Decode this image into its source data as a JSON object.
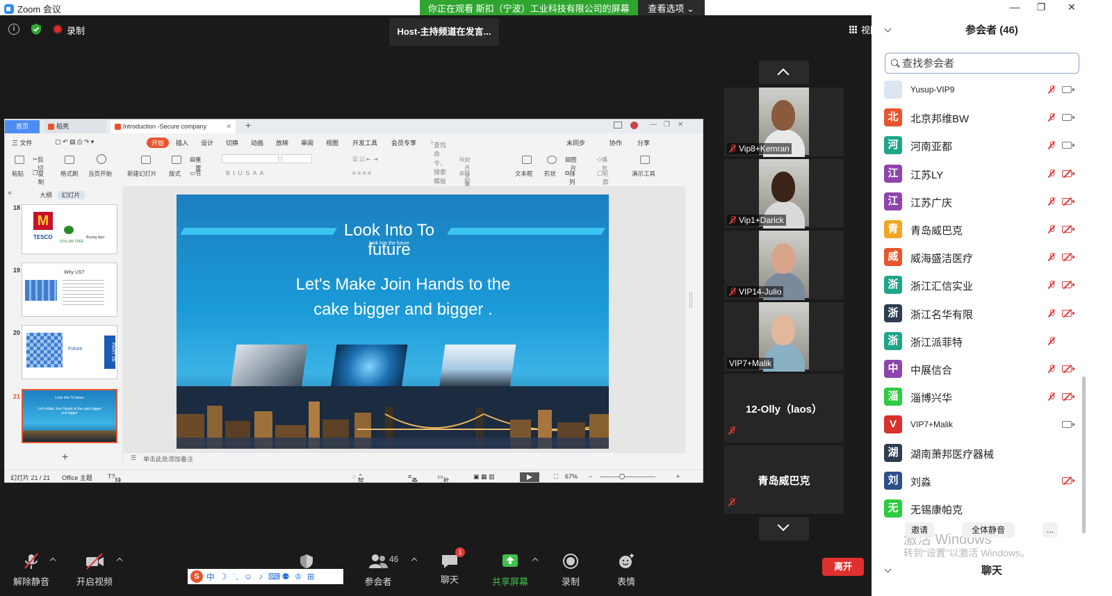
{
  "window": {
    "title": "Zoom 会议",
    "share_banner": "你正在观看 斯扣（宁波）工业科技有限公司的屏幕",
    "view_options": "查看选项 ⌄"
  },
  "meeting": {
    "recording_label": "录制",
    "speaker_banner": "Host-主持频道在发言...",
    "view_label": "视图"
  },
  "wps": {
    "tabs": {
      "home": "首页",
      "shell": "稻壳",
      "doc": "Introduction -Secure company"
    },
    "menu": {
      "file": "三 文件",
      "start": "开始",
      "items": [
        "插入",
        "设计",
        "切换",
        "动画",
        "放映",
        "审阅",
        "视图",
        "开发工具",
        "会员专享"
      ],
      "search": "查找命令、搜索模板",
      "right": [
        "未同步",
        "协作",
        "分享"
      ]
    },
    "ribbon": {
      "paste": "粘贴",
      "cut": "剪切",
      "copy": "复制",
      "format_painter": "格式刷",
      "play_from_current": "当页开始",
      "new_slide": "新建幻灯片",
      "layout": "版式",
      "section": "节",
      "reset": "重置",
      "align_text": "对齐文本",
      "convert_smartart": "转智能图形",
      "textbox": "文本框",
      "shape": "形状",
      "picture": "图片",
      "arrange": "排列",
      "fill": "填充",
      "outline": "轮廓",
      "presentation_tools": "演示工具"
    },
    "left_tabs": {
      "outline": "大纲",
      "slides": "幻灯片"
    },
    "thumbs": [
      {
        "num": "18",
        "text_a": "TESCO",
        "text_b": "DOLLAR TREE",
        "text_c": "Buying tiger"
      },
      {
        "num": "19",
        "text_a": "Why US?"
      },
      {
        "num": "20",
        "text_a": "Future",
        "text_b": "PART 05"
      },
      {
        "num": "21",
        "text_a": "Look Into To future",
        "text_b": "Let's Make Join Hands to the cake bigger and bigger"
      }
    ],
    "slide": {
      "title_line1": "Look Into To",
      "title_line2": "future",
      "subtitle_tiny": "look into the future",
      "body_line1": "Let's Make Join Hands to the",
      "body_line2": "cake bigger and bigger ."
    },
    "notes_placeholder": "单击此处添加备注",
    "status": {
      "slide_counter": "幻灯片 21 / 21",
      "theme": "Office 主题",
      "missing_fonts": "缺失字体",
      "beautify": "智能美化",
      "notes": "备注",
      "comments": "批注",
      "zoom": "67%"
    }
  },
  "videos": [
    {
      "name": "Vip8+Kemran",
      "skin": "#8a5a3c",
      "shirt": "#e8e8e8"
    },
    {
      "name": "Vip1+Darick",
      "skin": "#3a2418",
      "shirt": "#d9d9d9"
    },
    {
      "name": "VIP14-Julio",
      "skin": "#d9a58a",
      "shirt": "#7a8a9a"
    },
    {
      "name": "VIP7+Malik",
      "skin": "#e2b89c",
      "shirt": "#8ab0c4"
    },
    {
      "name": "12-Olly（laos）"
    },
    {
      "name": "青岛威巴克"
    }
  ],
  "participants": {
    "title": "参会者 (46)",
    "search_placeholder": "查找参会者",
    "list": [
      {
        "avatar": "",
        "name": "Yusup-VIP9",
        "color": "#d9e6f2",
        "mic": "off",
        "cam": "on"
      },
      {
        "avatar": "北",
        "name": "北京邦维BW",
        "color": "#e8552d",
        "mic": "off",
        "cam": "on"
      },
      {
        "avatar": "河",
        "name": "河南亚都",
        "color": "#1ea589",
        "mic": "off",
        "cam": "on"
      },
      {
        "avatar": "江",
        "name": "江苏LY",
        "color": "#8e44ad",
        "mic": "off",
        "cam": "off"
      },
      {
        "avatar": "江",
        "name": "江苏广庆",
        "color": "#8e44ad",
        "mic": "off",
        "cam": "off"
      },
      {
        "avatar": "青",
        "name": "青岛威巴克",
        "color": "#f2a623",
        "mic": "off",
        "cam": "off"
      },
      {
        "avatar": "威",
        "name": "威海盛洁医疗",
        "color": "#e8552d",
        "mic": "off",
        "cam": "off"
      },
      {
        "avatar": "浙",
        "name": "浙江汇信实业",
        "color": "#1ea589",
        "mic": "off",
        "cam": "off"
      },
      {
        "avatar": "浙",
        "name": "浙江名华有限",
        "color": "#2c3e50",
        "mic": "off",
        "cam": "off"
      },
      {
        "avatar": "浙",
        "name": "浙江派菲特",
        "color": "#1ea589",
        "mic": "off",
        "cam": "none"
      },
      {
        "avatar": "中",
        "name": "中展信合",
        "color": "#8e44ad",
        "mic": "off",
        "cam": "off"
      },
      {
        "avatar": "淄",
        "name": "淄博兴华",
        "color": "#2ecc40",
        "mic": "off",
        "cam": "off"
      },
      {
        "avatar": "V",
        "name": "VIP7+Malik",
        "color": "#d9302b",
        "mic": "none",
        "cam": "on"
      },
      {
        "avatar": "湖",
        "name": "湖南萧邦医疗器械",
        "color": "#2c3e50",
        "mic": "none",
        "cam": "none"
      },
      {
        "avatar": "刘",
        "name": "刘淼",
        "color": "#2c4f8a",
        "mic": "none",
        "cam": "off"
      },
      {
        "avatar": "无",
        "name": "无锡康帕克",
        "color": "#2ecc40",
        "mic": "none",
        "cam": "none"
      }
    ],
    "invite": "邀请",
    "mute_all": "全体静音",
    "more": "...",
    "watermark_line1": "激活 Windows",
    "watermark_line2": "转到“设置”以激活 Windows。",
    "chat_title": "聊天"
  },
  "toolbar": {
    "unmute": "解除静音",
    "start_video": "开启视频",
    "participants": "参会者",
    "participants_count": "46",
    "chat": "聊天",
    "chat_badge": "1",
    "share_screen": "共享屏幕",
    "record": "录制",
    "reactions": "表情",
    "leave": "离开"
  },
  "ime": {
    "logo": "S",
    "mode": "中"
  },
  "colors": {
    "accent": "#2d8cff",
    "share_green": "#2fa52f",
    "leave_red": "#e0302e",
    "wps_orange": "#e8552d"
  }
}
